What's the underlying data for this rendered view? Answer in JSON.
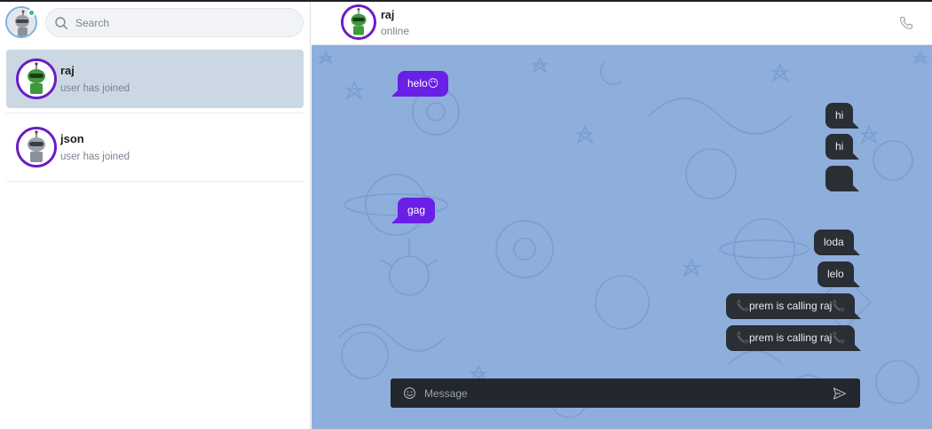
{
  "sidebar": {
    "search": {
      "placeholder": "Search",
      "value": ""
    },
    "chats": [
      {
        "name": "raj",
        "last_message": "user has joined",
        "avatar": "green-robot-avatar",
        "active": true
      },
      {
        "name": "json",
        "last_message": "user has joined",
        "avatar": "gray-robot-avatar",
        "active": false
      }
    ]
  },
  "header": {
    "name": "raj",
    "status": "online",
    "call_icon": "phone-icon"
  },
  "messages": [
    {
      "side": "in",
      "text": "helo😶"
    },
    {
      "side": "out",
      "text": "hi"
    },
    {
      "side": "out",
      "text": "hi"
    },
    {
      "side": "out",
      "text": ""
    },
    {
      "side": "in",
      "text": "gag"
    },
    {
      "side": "out",
      "text": "loda"
    },
    {
      "side": "out",
      "text": "lelo"
    },
    {
      "side": "out",
      "text": "📞prem is calling raj📞"
    },
    {
      "side": "out",
      "text": "📞prem is calling raj📞"
    }
  ],
  "composer": {
    "placeholder": "Message",
    "value": ""
  },
  "colors": {
    "accent": "#6a1cc4",
    "incoming_bubble": "#6a1fe6",
    "outgoing_bubble": "#2a2e35",
    "chat_background": "#8eaedc",
    "active_chat": "#ccd7e4"
  }
}
